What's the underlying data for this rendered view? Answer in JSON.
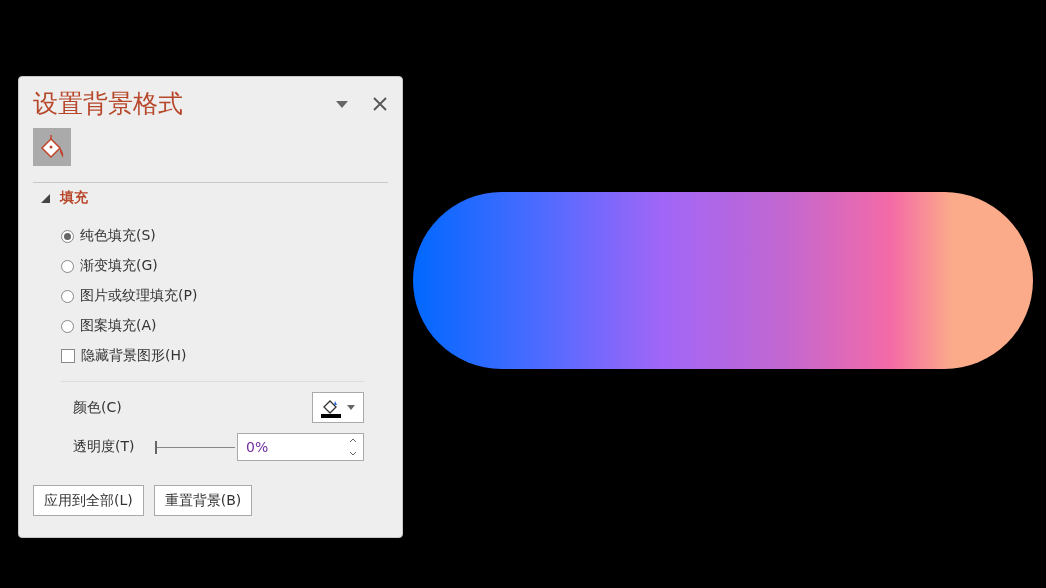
{
  "panel": {
    "title": "设置背景格式",
    "tabs": [
      {
        "kind": "fill",
        "selected": true
      }
    ],
    "section": {
      "label": "填充",
      "expanded": true
    },
    "options": [
      {
        "kind": "radio",
        "label": "纯色填充(S)",
        "selected": true
      },
      {
        "kind": "radio",
        "label": "渐变填充(G)",
        "selected": false
      },
      {
        "kind": "radio",
        "label": "图片或纹理填充(P)",
        "selected": false
      },
      {
        "kind": "radio",
        "label": "图案填充(A)",
        "selected": false
      },
      {
        "kind": "checkbox",
        "label": "隐藏背景图形(H)",
        "checked": false
      }
    ],
    "color": {
      "label": "颜色(C)",
      "color": "#000000"
    },
    "transparency": {
      "label": "透明度(T)",
      "level": 0,
      "value": "0%"
    },
    "buttons": [
      "应用到全部(L)",
      "重置背景(B)"
    ]
  }
}
